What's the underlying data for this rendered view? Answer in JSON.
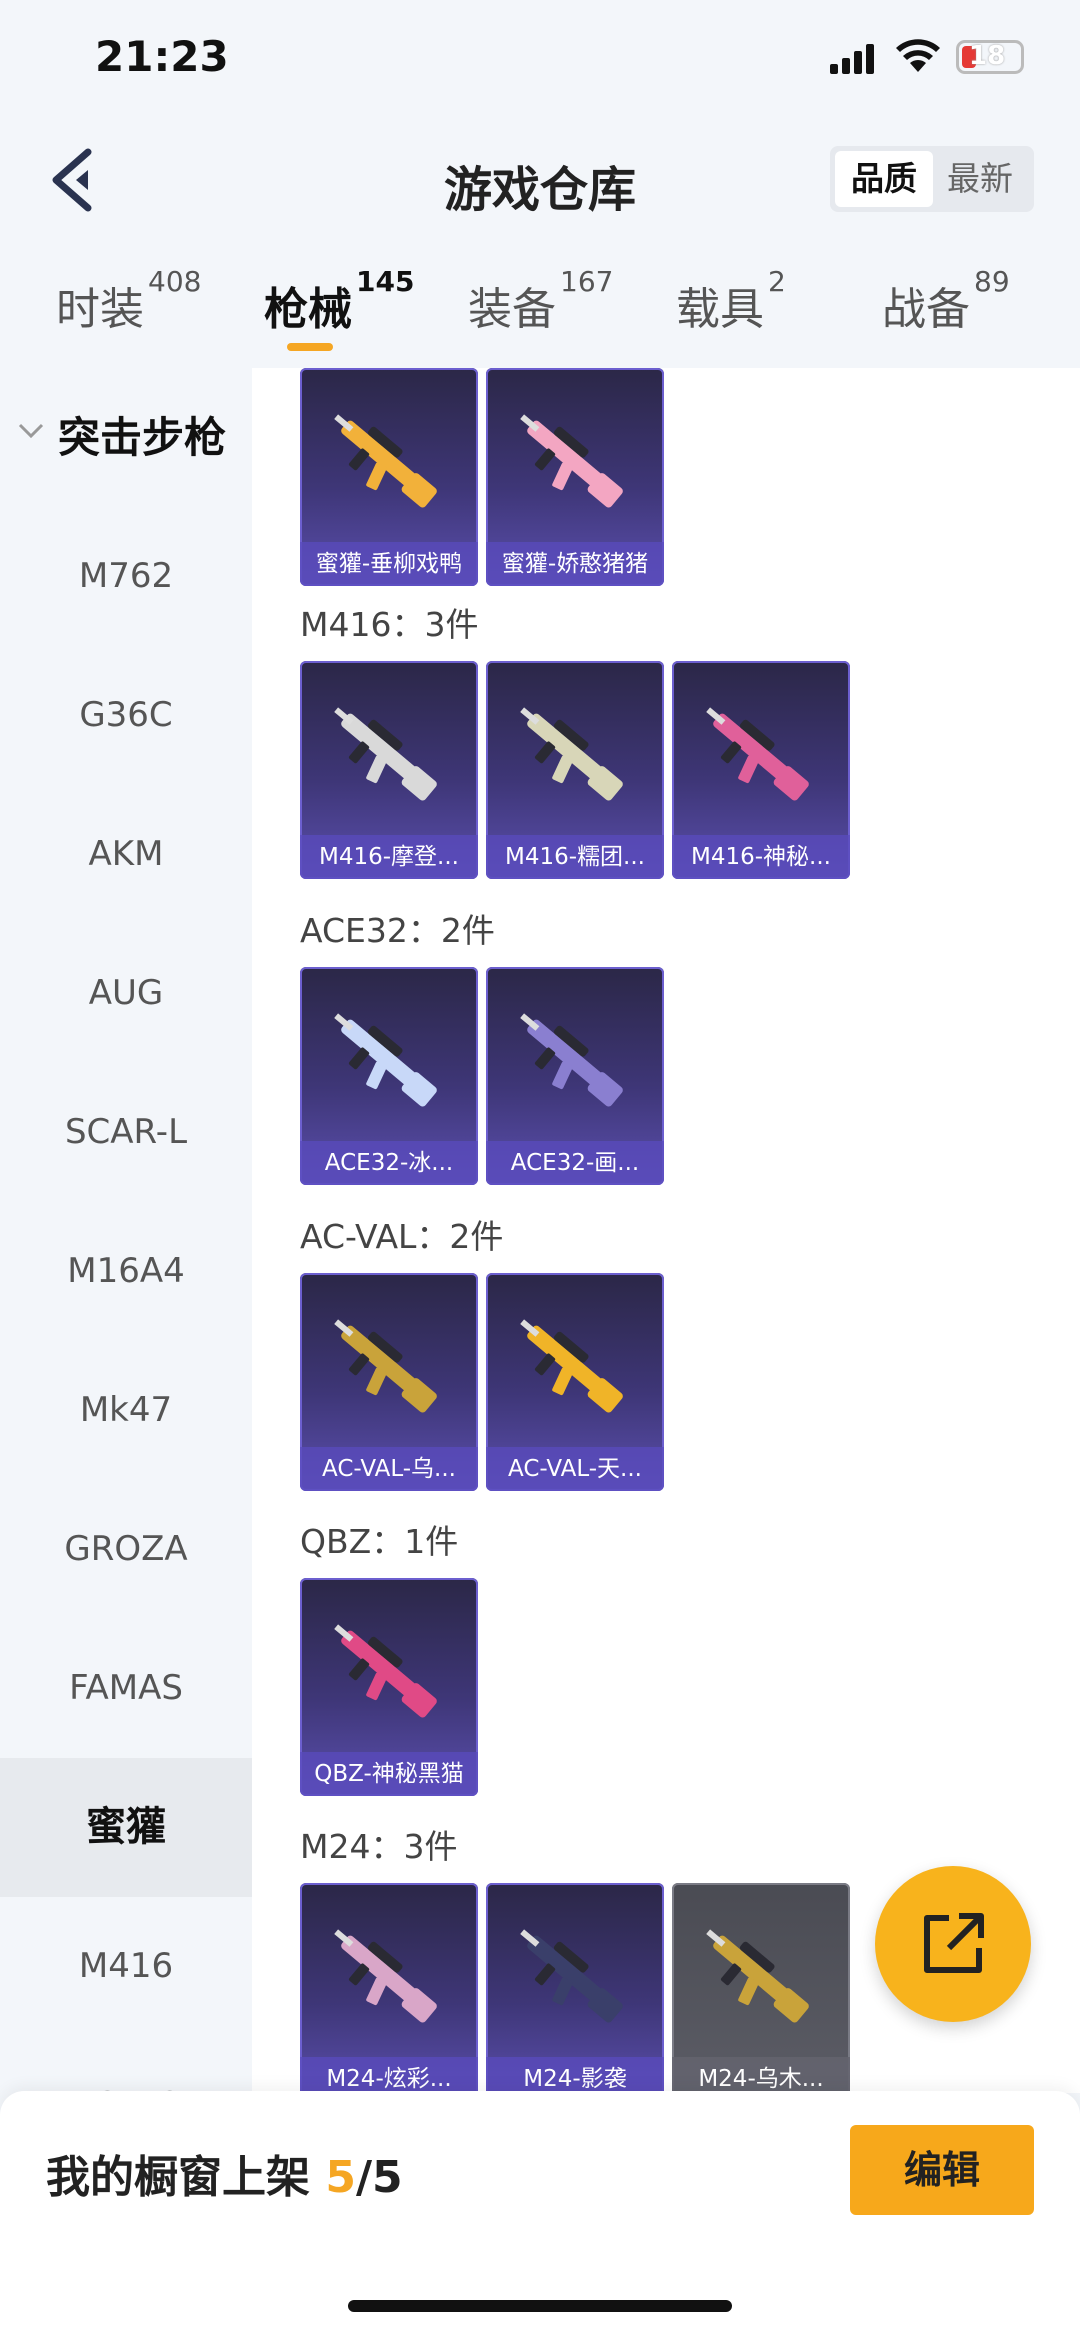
{
  "status": {
    "time": "21:23",
    "battery": "18"
  },
  "header": {
    "title": "游戏仓库",
    "sort_options": [
      "品质",
      "最新"
    ],
    "active_sort": "品质"
  },
  "tabs": [
    {
      "label": "时装",
      "count": "408"
    },
    {
      "label": "枪械",
      "count": "145"
    },
    {
      "label": "装备",
      "count": "167"
    },
    {
      "label": "载具",
      "count": "2"
    },
    {
      "label": "战备",
      "count": "89"
    }
  ],
  "active_tab": "枪械",
  "sidebar": {
    "category": "突击步枪",
    "items": [
      "M762",
      "G36C",
      "AKM",
      "AUG",
      "SCAR-L",
      "M16A4",
      "Mk47",
      "GROZA",
      "FAMAS",
      "蜜獾",
      "M416",
      "ACE32"
    ],
    "selected": "蜜獾"
  },
  "groups": [
    {
      "title": "",
      "items": [
        {
          "label": "蜜獾-垂柳戏鸭",
          "color": "#f2b13a"
        },
        {
          "label": "蜜獾-娇憨猪猪",
          "color": "#f3a6c2"
        }
      ]
    },
    {
      "title": "M416：3件",
      "items": [
        {
          "label": "M416-摩登...",
          "color": "#d9d9d9"
        },
        {
          "label": "M416-糯团...",
          "color": "#d8d6b8"
        },
        {
          "label": "M416-神秘...",
          "color": "#e0609a"
        }
      ]
    },
    {
      "title": "ACE32：2件",
      "items": [
        {
          "label": "ACE32-冰...",
          "color": "#c8d8f8"
        },
        {
          "label": "ACE32-画...",
          "color": "#8a7fd0"
        }
      ]
    },
    {
      "title": "AC-VAL：2件",
      "items": [
        {
          "label": "AC-VAL-乌...",
          "color": "#c9a33a"
        },
        {
          "label": "AC-VAL-天...",
          "color": "#f0b428"
        }
      ]
    },
    {
      "title": "QBZ：1件",
      "items": [
        {
          "label": "QBZ-神秘黑猫",
          "color": "#e04a86"
        }
      ]
    },
    {
      "title": "M24：3件",
      "items": [
        {
          "label": "M24-炫彩...",
          "color": "#d9a6c8"
        },
        {
          "label": "M24-影袭",
          "color": "#3a3f6a"
        },
        {
          "label": "M24-乌木...",
          "color": "#c9a33a",
          "gray": true
        }
      ]
    }
  ],
  "bottom": {
    "showcase_label": "我的橱窗上架",
    "showcase_count": "5",
    "showcase_total": "/5",
    "edit_label": "编辑"
  }
}
